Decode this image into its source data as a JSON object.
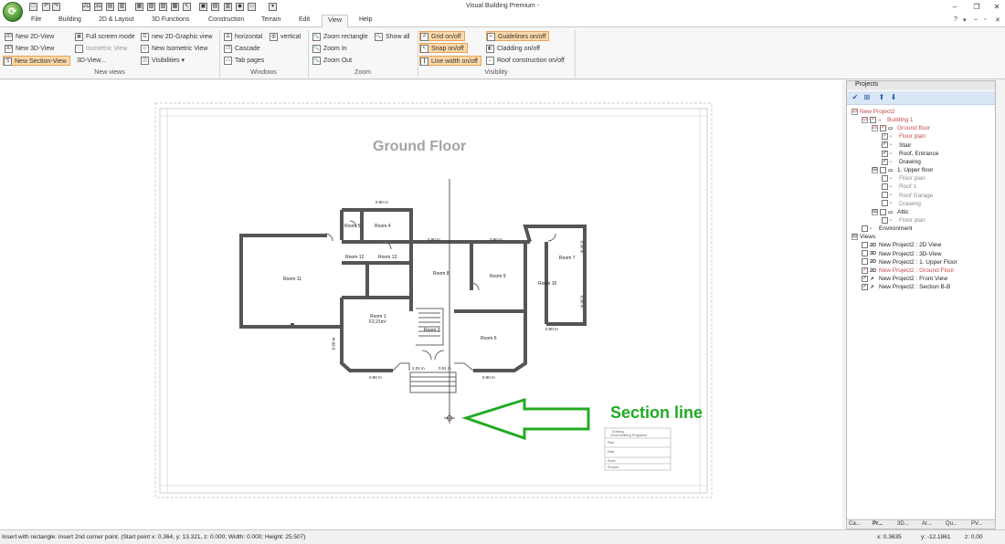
{
  "app": {
    "window_title": "Visual Building Premium -",
    "logo_glyph": "⟳",
    "quick_access": [
      "□",
      "↶",
      "↷",
      "2D",
      "3D",
      "▤",
      "▥",
      "▦",
      "▧",
      "▨",
      "▩",
      "↖",
      "▣",
      "▤",
      "▥",
      "◆",
      "▭",
      "▾"
    ],
    "window_buttons": [
      "–",
      "❐",
      "✕"
    ],
    "help_icons": [
      "?",
      "▾",
      "–",
      "▫",
      "✕"
    ]
  },
  "menu": {
    "tabs": [
      "File",
      "Building",
      "2D & Layout",
      "3D Functions",
      "Construction",
      "Terrain",
      "Edit",
      "View",
      "Help"
    ],
    "active": "View"
  },
  "ribbon": {
    "new_views": {
      "label": "New views",
      "items": [
        "New 2D-View",
        "New 3D-View",
        "New Section-View",
        "Full screen mode",
        "Isometric View",
        "3D-View...",
        "new 2D-Graphic view",
        "New Isometric View",
        "Visibilities"
      ]
    },
    "windows": {
      "label": "Windows",
      "items": [
        "horizontal",
        "vertical",
        "Cascade",
        "Tab pages"
      ]
    },
    "zoom": {
      "label": "Zoom",
      "items": [
        "Zoom rectangle",
        "Show all",
        "Zoom In",
        "Zoom Out"
      ]
    },
    "visibility": {
      "label": "Visibility",
      "items": [
        "Grid on/off",
        "Guidelines on/off",
        "Snap on/off",
        "Cladding on/off",
        "Line width on/off",
        "Roof construction on/off"
      ]
    },
    "icons": {
      "2d": "2D",
      "3d": "3D",
      "section": "S",
      "fullscreen": "▦",
      "iso": "◇",
      "graphic": "G",
      "visib": "◫",
      "horiz": "☰",
      "vert": "▥",
      "cascade": "❐",
      "tabs": "▭",
      "zoom": "🔍",
      "grid": "#",
      "guide": "⊢",
      "snap": "↖",
      "clad": "◧",
      "linew": "┃",
      "roof": "⌂"
    }
  },
  "canvas": {
    "title": "Ground Floor",
    "rooms": [
      "Room 11",
      "Room 4",
      "Room 5",
      "Room 12",
      "Room 13",
      "Room 8",
      "Room 9",
      "Room 7",
      "Room 10",
      "Room 1",
      "Room 3",
      "Room 6"
    ],
    "room1_sub": "F2.21m²",
    "dims": [
      "0.90 m",
      "0.90 m",
      "0.90 m",
      "0.90 m",
      "0.90 m",
      "0.90 m",
      "2.01 m",
      "0.01 m",
      "0.90 m",
      "0.90 m",
      "0.90 m"
    ],
    "annotation_label": "Section line",
    "stamp_lines": [
      "Drawing",
      "Visual Building Programm",
      "Plan",
      "Date",
      "Scale",
      "Product"
    ],
    "annotation_color": "#22aa22"
  },
  "projects_panel": {
    "title": "Projects",
    "toolbar": [
      "✔",
      "⊠",
      "⬆",
      "⬇"
    ],
    "tree": [
      {
        "text": "New Project2",
        "cls": "red",
        "indent": 0,
        "exp": "⊟",
        "chk": null,
        "icon": null
      },
      {
        "text": "Building 1",
        "cls": "red",
        "indent": 1,
        "exp": "⊟",
        "chk": "✓",
        "icon": "⌂"
      },
      {
        "text": "Ground floor",
        "cls": "red",
        "indent": 2,
        "exp": "⊟",
        "chk": "✓",
        "icon": "▭"
      },
      {
        "text": "Floor plan",
        "cls": "red",
        "indent": 3,
        "exp": null,
        "chk": "✓",
        "icon": "▫"
      },
      {
        "text": "Stair",
        "cls": "",
        "indent": 3,
        "exp": null,
        "chk": "✓",
        "icon": "▫"
      },
      {
        "text": "Roof, Entrance",
        "cls": "",
        "indent": 3,
        "exp": null,
        "chk": "✓",
        "icon": "▫"
      },
      {
        "text": "Drawing",
        "cls": "",
        "indent": 3,
        "exp": null,
        "chk": "✓",
        "icon": "▫"
      },
      {
        "text": "1. Upper floor",
        "cls": "",
        "indent": 2,
        "exp": "⊟",
        "chk": "",
        "icon": "▭"
      },
      {
        "text": "Floor plan",
        "cls": "grey",
        "indent": 3,
        "exp": null,
        "chk": "",
        "icon": "▫"
      },
      {
        "text": "Roof 1",
        "cls": "grey",
        "indent": 3,
        "exp": null,
        "chk": "",
        "icon": "▫"
      },
      {
        "text": "Roof Garage",
        "cls": "grey",
        "indent": 3,
        "exp": null,
        "chk": "",
        "icon": "▫"
      },
      {
        "text": "Drawing",
        "cls": "grey",
        "indent": 3,
        "exp": null,
        "chk": "",
        "icon": "▫"
      },
      {
        "text": "Attic",
        "cls": "",
        "indent": 2,
        "exp": "⊟",
        "chk": "",
        "icon": "▭"
      },
      {
        "text": "Floor plan",
        "cls": "grey",
        "indent": 3,
        "exp": null,
        "chk": "",
        "icon": "▫"
      },
      {
        "text": "Environment",
        "cls": "",
        "indent": 1,
        "exp": null,
        "chk": "",
        "icon": "▫"
      },
      {
        "text": "Views",
        "cls": "",
        "indent": 0,
        "exp": "⊟",
        "chk": null,
        "icon": null
      },
      {
        "text": "New Project2 : 2D View",
        "cls": "",
        "indent": 1,
        "exp": null,
        "chk": "",
        "icon": "2D"
      },
      {
        "text": "New Project2 : 3D-View",
        "cls": "",
        "indent": 1,
        "exp": null,
        "chk": "",
        "icon": "3D"
      },
      {
        "text": "New Project2 : 1. Upper Floor",
        "cls": "",
        "indent": 1,
        "exp": null,
        "chk": "",
        "icon": "2D"
      },
      {
        "text": "New Project2 : Ground Floor",
        "cls": "red",
        "indent": 1,
        "exp": null,
        "chk": "✓",
        "icon": "2D"
      },
      {
        "text": "New Project2 : Front View",
        "cls": "",
        "indent": 1,
        "exp": null,
        "chk": "✓",
        "icon": "↗"
      },
      {
        "text": "New Project2 : Section B-B",
        "cls": "",
        "indent": 1,
        "exp": null,
        "chk": "✓",
        "icon": "↗"
      }
    ],
    "bottom_tabs": [
      "Ca...",
      "Pr...",
      "3D...",
      "Ar...",
      "Qu...",
      "PV..."
    ]
  },
  "status": {
    "message": "Insert with rectangle: Insert 2nd corner point. (Start point  x:  0.364,  y: 13.321,  z:  0.000;  Width:  0.000;  Height: 25.507)",
    "x": "x: 0.3635",
    "y": "y: -12.1861",
    "z": "z: 0.00"
  }
}
